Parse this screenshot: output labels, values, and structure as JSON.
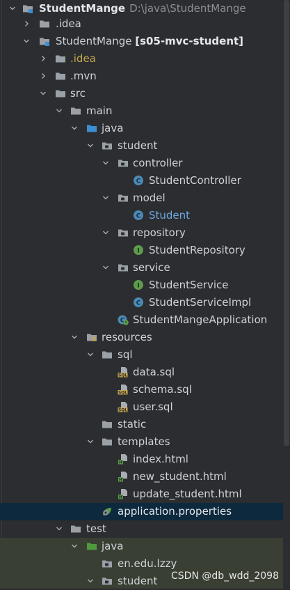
{
  "root": {
    "name": "StudentMange",
    "path": "D:\\java\\StudentMange"
  },
  "rows": [
    {
      "label": ".idea"
    },
    {
      "label": "StudentMange",
      "suffix": "[s05-mvc-student]"
    },
    {
      "label": ".idea"
    },
    {
      "label": ".mvn"
    },
    {
      "label": "src"
    },
    {
      "label": "main"
    },
    {
      "label": "java"
    },
    {
      "label": "student"
    },
    {
      "label": "controller"
    },
    {
      "label": "StudentController"
    },
    {
      "label": "model"
    },
    {
      "label": "Student"
    },
    {
      "label": "repository"
    },
    {
      "label": "StudentRepository"
    },
    {
      "label": "service"
    },
    {
      "label": "StudentService"
    },
    {
      "label": "StudentServiceImpl"
    },
    {
      "label": "StudentMangeApplication"
    },
    {
      "label": "resources"
    },
    {
      "label": "sql"
    },
    {
      "label": "data.sql"
    },
    {
      "label": "schema.sql"
    },
    {
      "label": "user.sql"
    },
    {
      "label": "static"
    },
    {
      "label": "templates"
    },
    {
      "label": "index.html"
    },
    {
      "label": "new_student.html"
    },
    {
      "label": "update_student.html"
    },
    {
      "label": "application.properties"
    },
    {
      "label": "test"
    },
    {
      "label": "java"
    },
    {
      "label": "en.edu.lzzy"
    },
    {
      "label": "student"
    }
  ],
  "watermark": "CSDN @db_wdd_2098",
  "colors": {
    "background": "#2b2d30",
    "selected_row": "#0d293e",
    "folder": "#9aa0a6",
    "source_folder": "#3d8fd1",
    "test_folder": "#4e9a3d",
    "class_icon": "#4a8ab6",
    "interface_icon": "#5e9b4c",
    "excluded_yellow": "#c8a84f",
    "modified_blue": "#6fa8e0"
  }
}
